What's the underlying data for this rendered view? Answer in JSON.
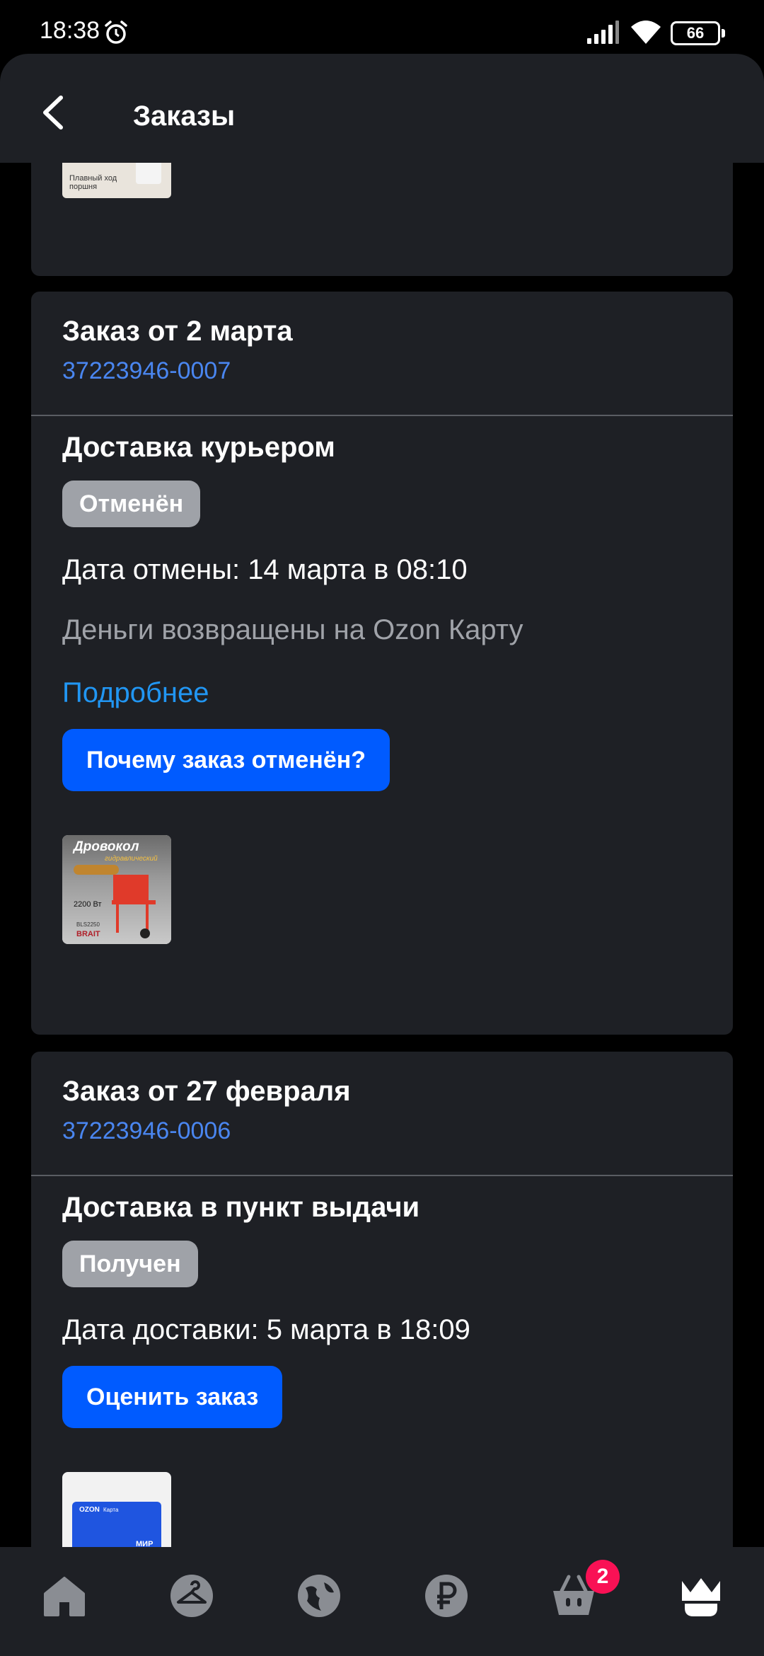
{
  "status_bar": {
    "time": "18:38",
    "battery": "66"
  },
  "header": {
    "title": "Заказы"
  },
  "top_card": {
    "thumb_caption": "Плавный ход поршня"
  },
  "orders": [
    {
      "title": "Заказ от 2 марта",
      "number": "37223946-0007",
      "delivery": "Доставка курьером",
      "status": "Отменён",
      "date_line": "Дата отмены: 14 марта в 08:10",
      "refund_note": "Деньги возвращены на Ozon Карту",
      "details_link": "Подробнее",
      "action_button": "Почему заказ отменён?",
      "thumb": {
        "title": "Дровокол",
        "subtitle": "гидравлический",
        "power": "2200 Вт",
        "model": "BLS2250",
        "brand": "BRAIT"
      }
    },
    {
      "title": "Заказ от 27 февраля",
      "number": "37223946-0006",
      "delivery": "Доставка в пункт выдачи",
      "status": "Получен",
      "date_line": "Дата доставки: 5 марта в 18:09",
      "action_button": "Оценить заказ",
      "thumb": {
        "brand": "OZON",
        "label": "Карта",
        "system": "МИР"
      }
    }
  ],
  "bottom_nav": {
    "cart_badge": "2"
  },
  "colors": {
    "background": "#000000",
    "card": "#1e2025",
    "accent": "#005bff",
    "link": "#2196f3",
    "order_number": "#4a86f0",
    "badge": "#9fa2a8",
    "cart_badge": "#f91155"
  },
  "icons": [
    "back-arrow-icon",
    "alarm-icon",
    "signal-icon",
    "wifi-icon",
    "battery-icon",
    "home-icon",
    "hanger-icon",
    "globe-icon",
    "ruble-icon",
    "cart-icon",
    "crown-icon"
  ]
}
